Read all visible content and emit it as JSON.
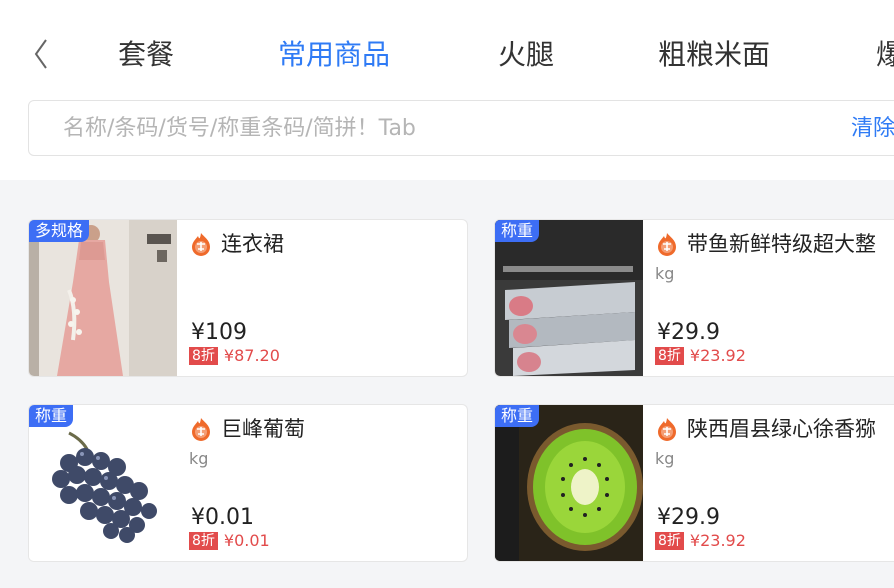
{
  "nav": {
    "tabs": [
      {
        "label": "套餐",
        "active": false
      },
      {
        "label": "常用商品",
        "active": true
      },
      {
        "label": "火腿",
        "active": false
      },
      {
        "label": "粗粮米面",
        "active": false
      },
      {
        "label": "爆",
        "active": false
      }
    ]
  },
  "search": {
    "placeholder": "名称/条码/货号/称重条码/简拼！Tab",
    "clear_label": "清除"
  },
  "colors": {
    "accent": "#2f7bf5",
    "badge": "#3d6ef5",
    "discount": "#e24b4b",
    "promo_icon": "#ef6a2b"
  },
  "products": [
    {
      "badge": "多规格",
      "name": "连衣裙",
      "unit": "",
      "price": "¥109",
      "discount_tag": "8折",
      "discount_price": "¥87.20",
      "image": "dress-photo"
    },
    {
      "badge": "称重",
      "name": "带鱼新鲜特级超大整",
      "unit": "kg",
      "price": "¥29.9",
      "discount_tag": "8折",
      "discount_price": "¥23.92",
      "image": "hairtail-fish-photo"
    },
    {
      "badge": "称重",
      "name": "巨峰葡萄",
      "unit": "kg",
      "price": "¥0.01",
      "discount_tag": "8折",
      "discount_price": "¥0.01",
      "image": "grape-photo"
    },
    {
      "badge": "称重",
      "name": "陕西眉县绿心徐香猕",
      "unit": "kg",
      "price": "¥29.9",
      "discount_tag": "8折",
      "discount_price": "¥23.92",
      "image": "kiwi-photo"
    }
  ]
}
